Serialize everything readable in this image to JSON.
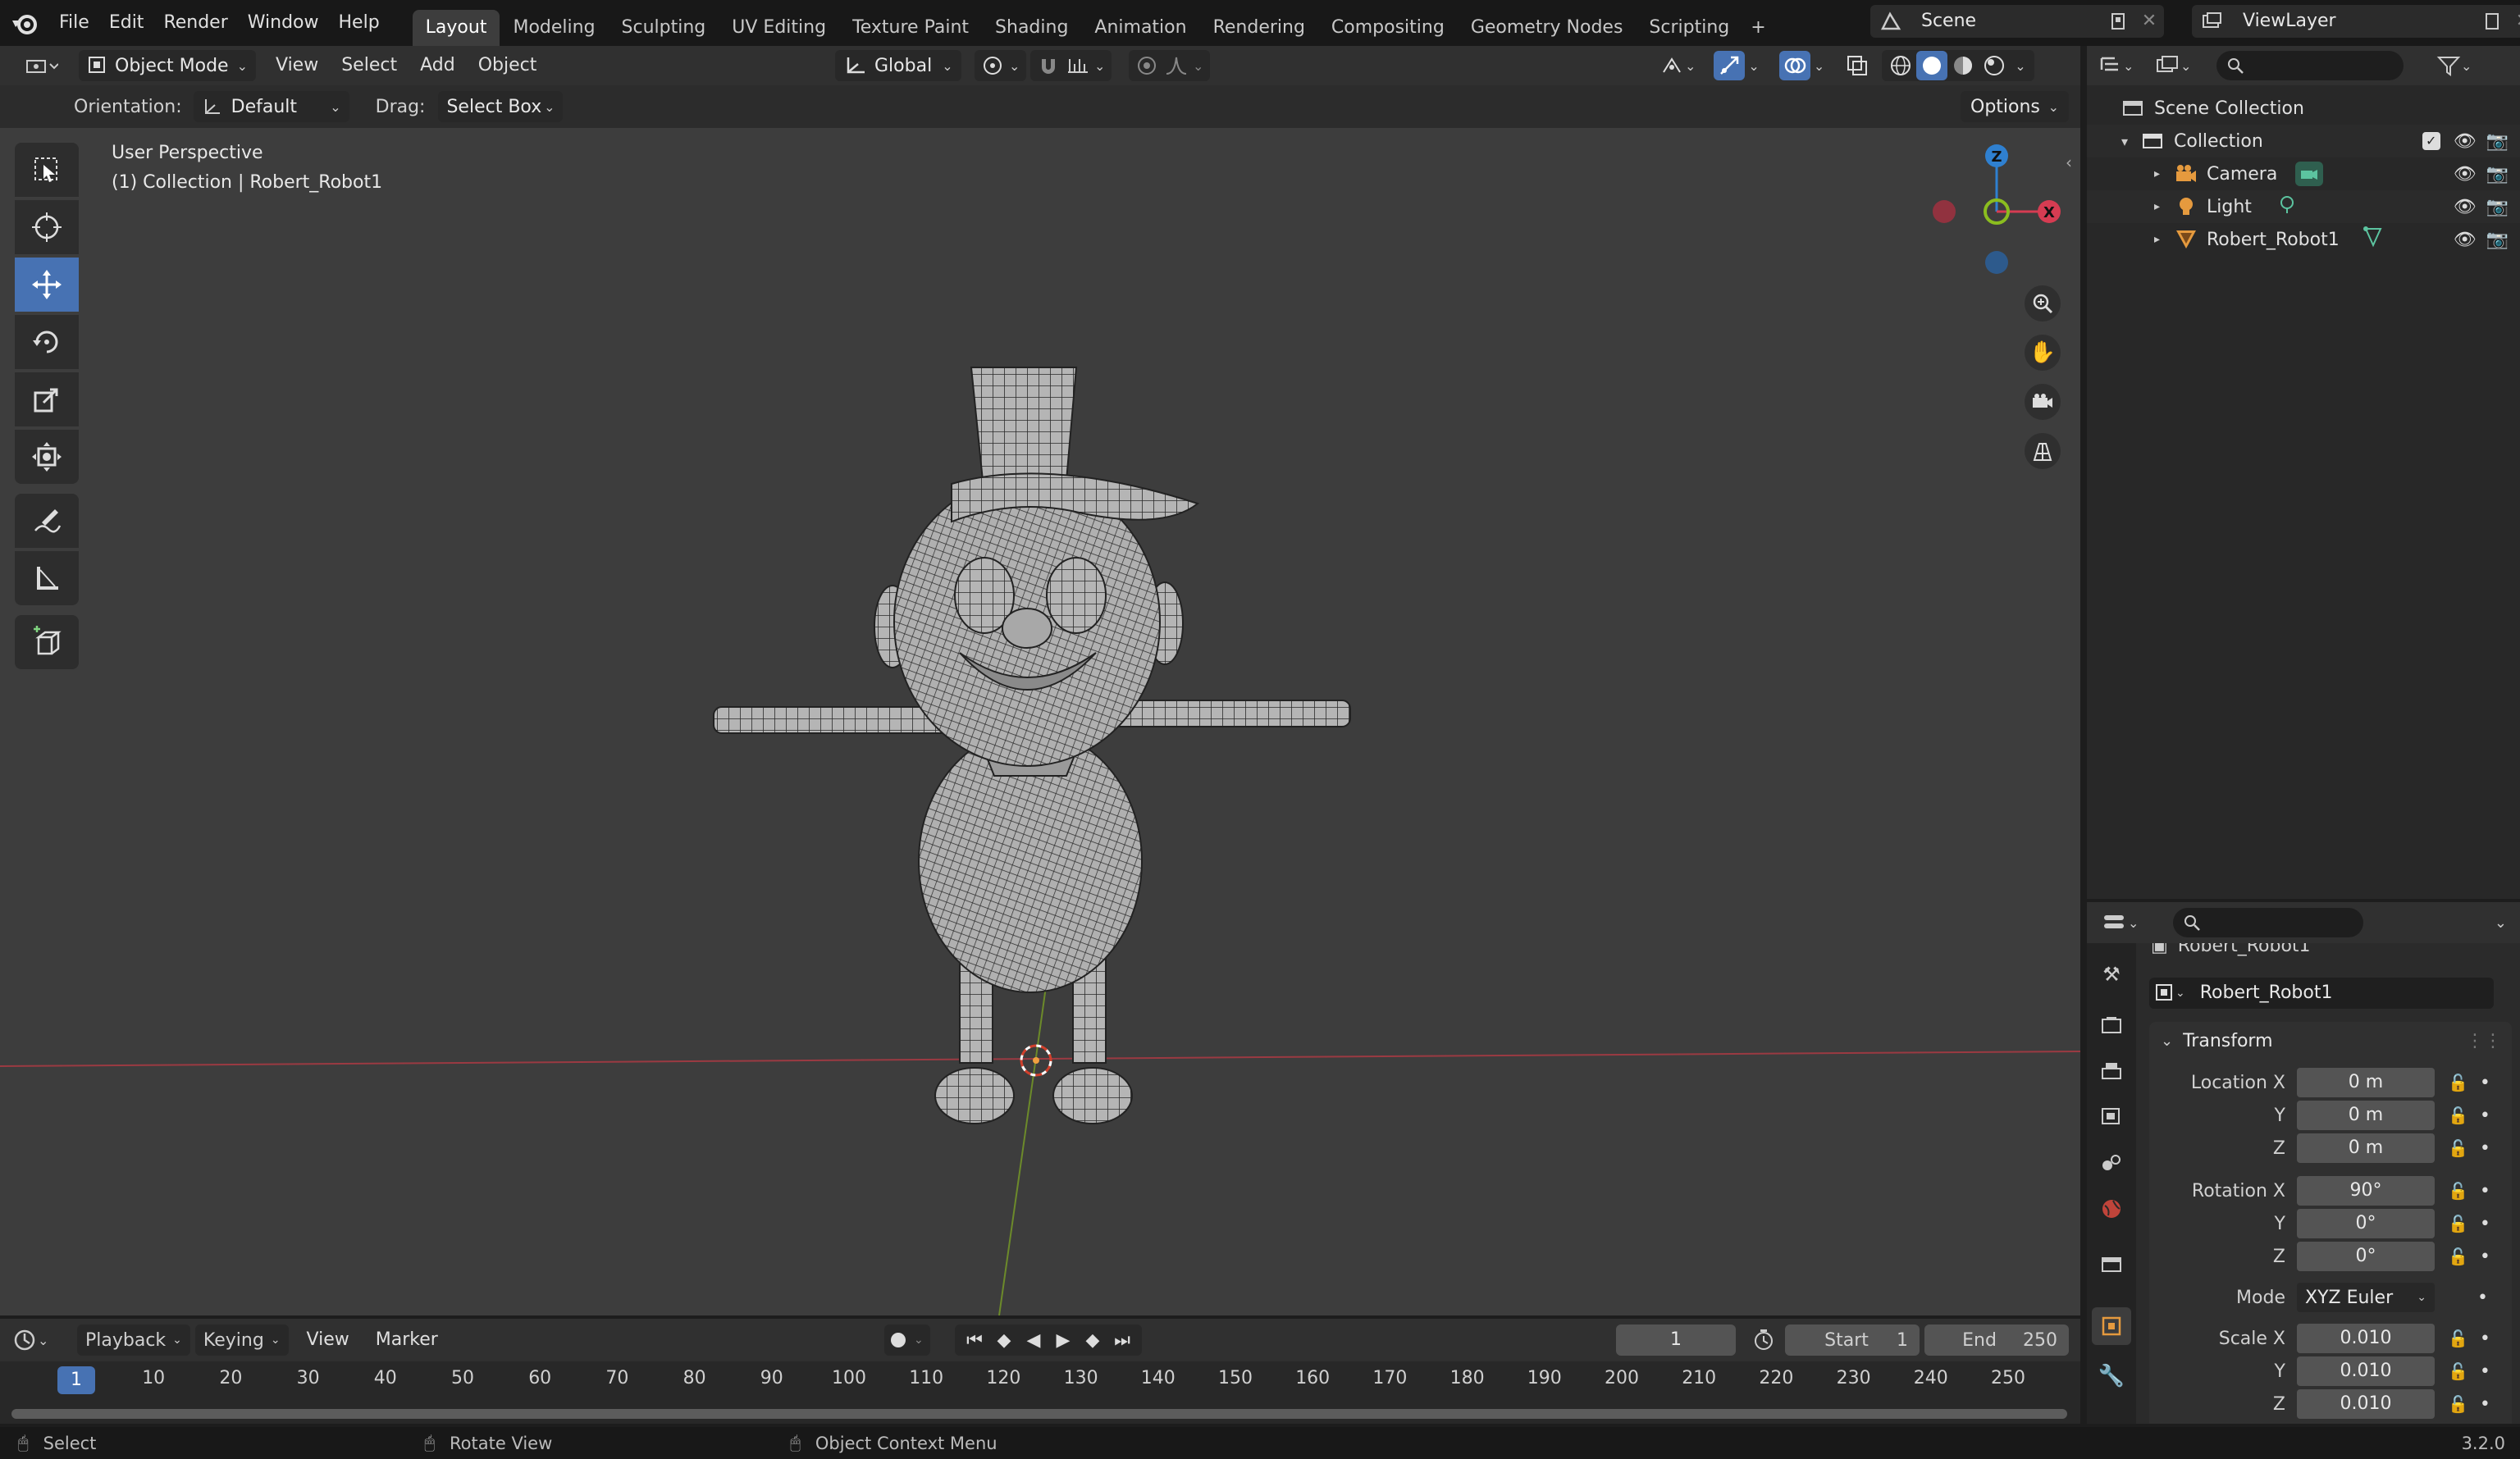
{
  "topbar": {
    "menu": [
      "File",
      "Edit",
      "Render",
      "Window",
      "Help"
    ],
    "workspaces": [
      "Layout",
      "Modeling",
      "Sculpting",
      "UV Editing",
      "Texture Paint",
      "Shading",
      "Animation",
      "Rendering",
      "Compositing",
      "Geometry Nodes",
      "Scripting"
    ],
    "add_tab": "+",
    "scene_name": "Scene",
    "view_layer": "ViewLayer"
  },
  "viewport_header": {
    "mode": "Object Mode",
    "menus": [
      "View",
      "Select",
      "Add",
      "Object"
    ],
    "transform_orientation": "Global",
    "options_label": "Options"
  },
  "tool_settings": {
    "orientation_label": "Orientation:",
    "orientation_value": "Default",
    "drag_label": "Drag:",
    "drag_value": "Select Box"
  },
  "viewport": {
    "perspective": "User Perspective",
    "collection_info": "(1) Collection | Robert_Robot1",
    "gizmo": {
      "z": "Z",
      "x": "X"
    }
  },
  "outliner": {
    "root": "Scene Collection",
    "collection": "Collection",
    "items": [
      "Camera",
      "Light",
      "Robert_Robot1"
    ]
  },
  "properties": {
    "object_name_top": "Robert_Robot1",
    "object_name": "Robert_Robot1",
    "panel_title": "Transform",
    "location": {
      "label": "Location X",
      "x": "0 m",
      "y": "0 m",
      "z": "0 m"
    },
    "rotation": {
      "label": "Rotation X",
      "x": "90°",
      "y": "0°",
      "z": "0°"
    },
    "mode_label": "Mode",
    "mode_value": "XYZ Euler",
    "scale": {
      "label": "Scale X",
      "x": "0.010",
      "y": "0.010",
      "z": "0.010"
    },
    "axis_y": "Y",
    "axis_z": "Z"
  },
  "timeline": {
    "menus": [
      "Playback",
      "Keying",
      "View",
      "Marker"
    ],
    "current_frame": "1",
    "start_label": "Start",
    "start_value": "1",
    "end_label": "End",
    "end_value": "250",
    "ticks": [
      "1",
      "10",
      "20",
      "30",
      "40",
      "50",
      "60",
      "70",
      "80",
      "90",
      "100",
      "110",
      "120",
      "130",
      "140",
      "150",
      "160",
      "170",
      "180",
      "190",
      "200",
      "210",
      "220",
      "230",
      "240",
      "250"
    ]
  },
  "statusbar": {
    "select": "Select",
    "rotate": "Rotate View",
    "context": "Object Context Menu",
    "version": "3.2.0"
  },
  "colors": {
    "accent": "#4772b3",
    "x_axis": "#d63c52",
    "y_axis": "#8bbd1f",
    "z_axis": "#2f80d0",
    "viewport_bg": "#3d3d3d"
  }
}
